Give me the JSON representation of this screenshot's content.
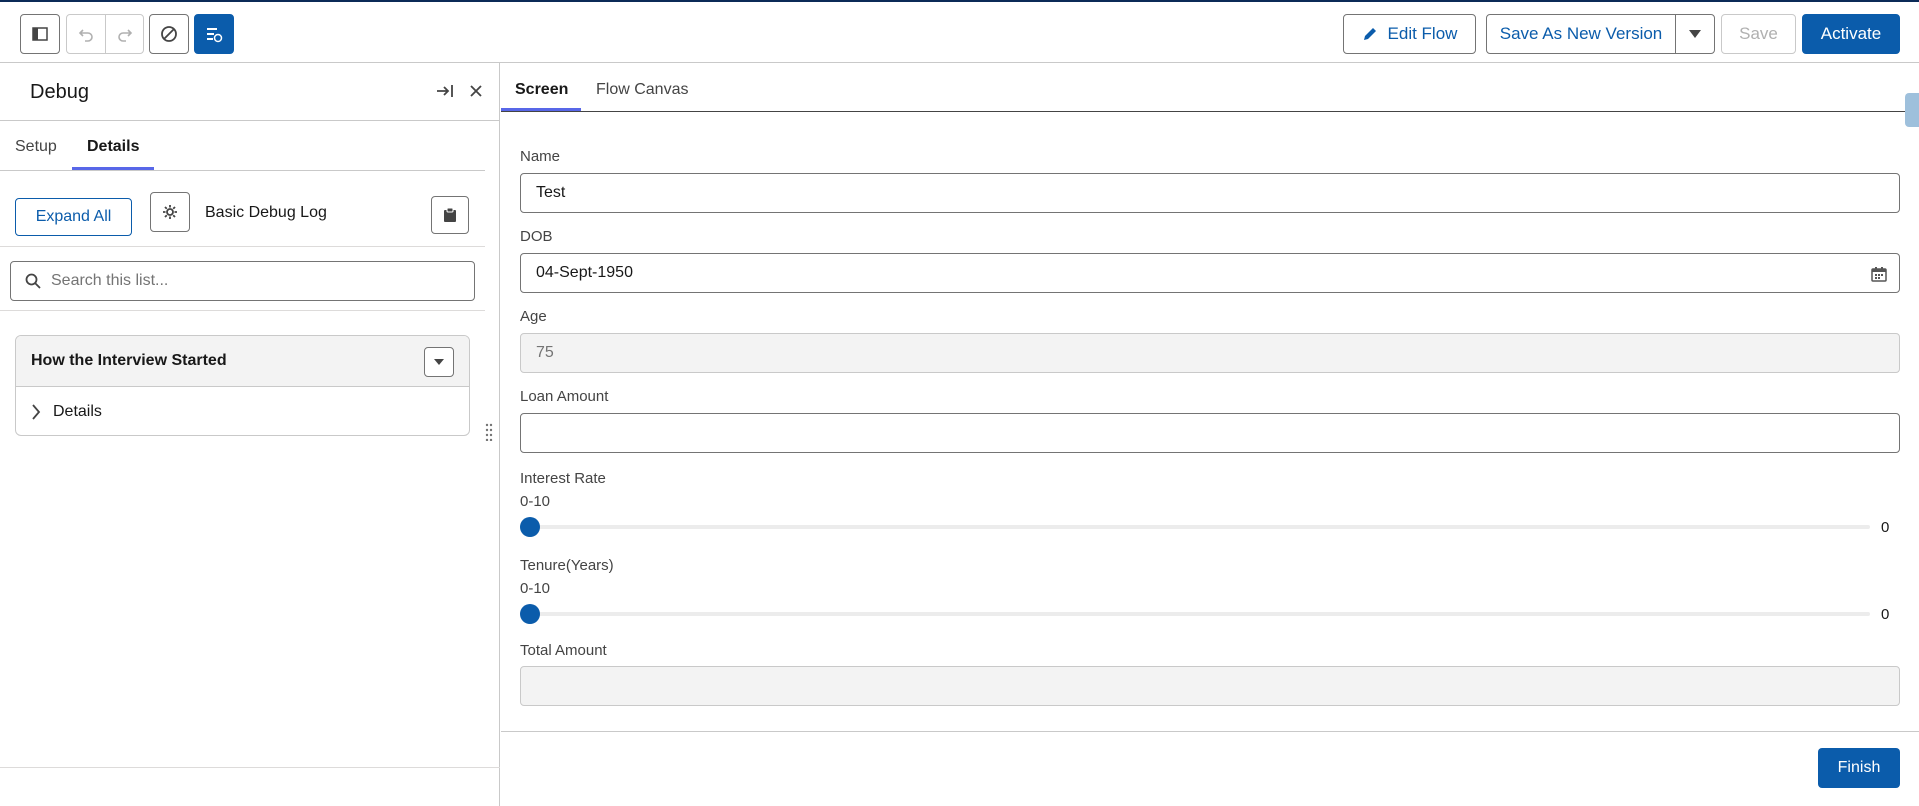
{
  "toolbar": {
    "edit_flow_label": "Edit Flow",
    "save_as_new_version_label": "Save As New Version",
    "save_label": "Save",
    "activate_label": "Activate"
  },
  "debug_panel": {
    "title": "Debug",
    "tabs": [
      {
        "label": "Setup",
        "active": false
      },
      {
        "label": "Details",
        "active": true
      }
    ],
    "expand_all_label": "Expand All",
    "log_level_label": "Basic Debug Log",
    "search": {
      "placeholder": "Search this list..."
    },
    "section": {
      "title": "How the Interview Started",
      "row_label": "Details"
    }
  },
  "main": {
    "tabs": [
      {
        "label": "Screen",
        "active": true
      },
      {
        "label": "Flow Canvas",
        "active": false
      }
    ],
    "fields": {
      "name": {
        "label": "Name",
        "value": "Test"
      },
      "dob": {
        "label": "DOB",
        "value": "04-Sept-1950"
      },
      "age": {
        "label": "Age",
        "value": "75"
      },
      "loan_amount": {
        "label": "Loan Amount",
        "value": ""
      },
      "interest_rate": {
        "label": "Interest Rate",
        "range": "0-10",
        "value": "0"
      },
      "tenure": {
        "label": "Tenure(Years)",
        "range": "0-10",
        "value": "0"
      },
      "total_amount": {
        "label": "Total Amount",
        "value": ""
      }
    },
    "finish_label": "Finish"
  },
  "colors": {
    "brand": "#0b5cab",
    "tab_accent": "#5867e8",
    "border": "#c9c9c9"
  }
}
